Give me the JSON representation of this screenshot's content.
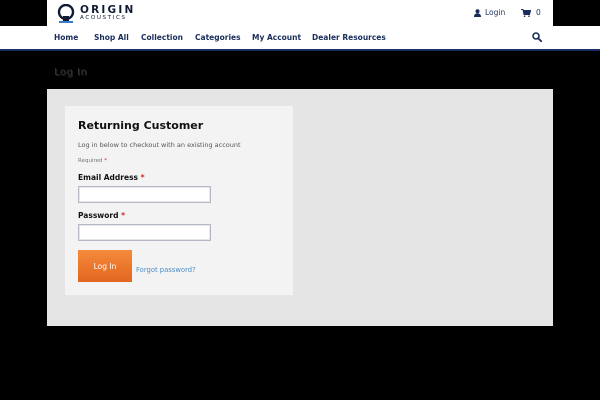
{
  "header": {
    "logo_main": "ORIGIN",
    "logo_sub": "ACOUSTICS",
    "login_label": "Login",
    "cart_count": "0"
  },
  "nav": {
    "items": [
      "Home",
      "Shop All",
      "Collection",
      "Categories",
      "My Account",
      "Dealer Resources"
    ]
  },
  "page": {
    "title": "Log In"
  },
  "login_form": {
    "title": "Returning Customer",
    "subtitle": "Log in below to checkout with an existing account",
    "required_label": "Required",
    "required_marker": "*",
    "email_label": "Email Address",
    "email_value": "",
    "password_label": "Password",
    "password_value": "",
    "submit_label": "Log In",
    "forgot_label": "Forgot password?"
  },
  "colors": {
    "background": "#000000",
    "nav_text": "#1a2d5a",
    "nav_border": "#1a2e66",
    "button": "#ee7a2e",
    "link": "#4c8fc8",
    "required": "#d02626"
  },
  "icons": [
    "logo-mark-icon",
    "user-icon",
    "cart-icon",
    "search-icon"
  ]
}
